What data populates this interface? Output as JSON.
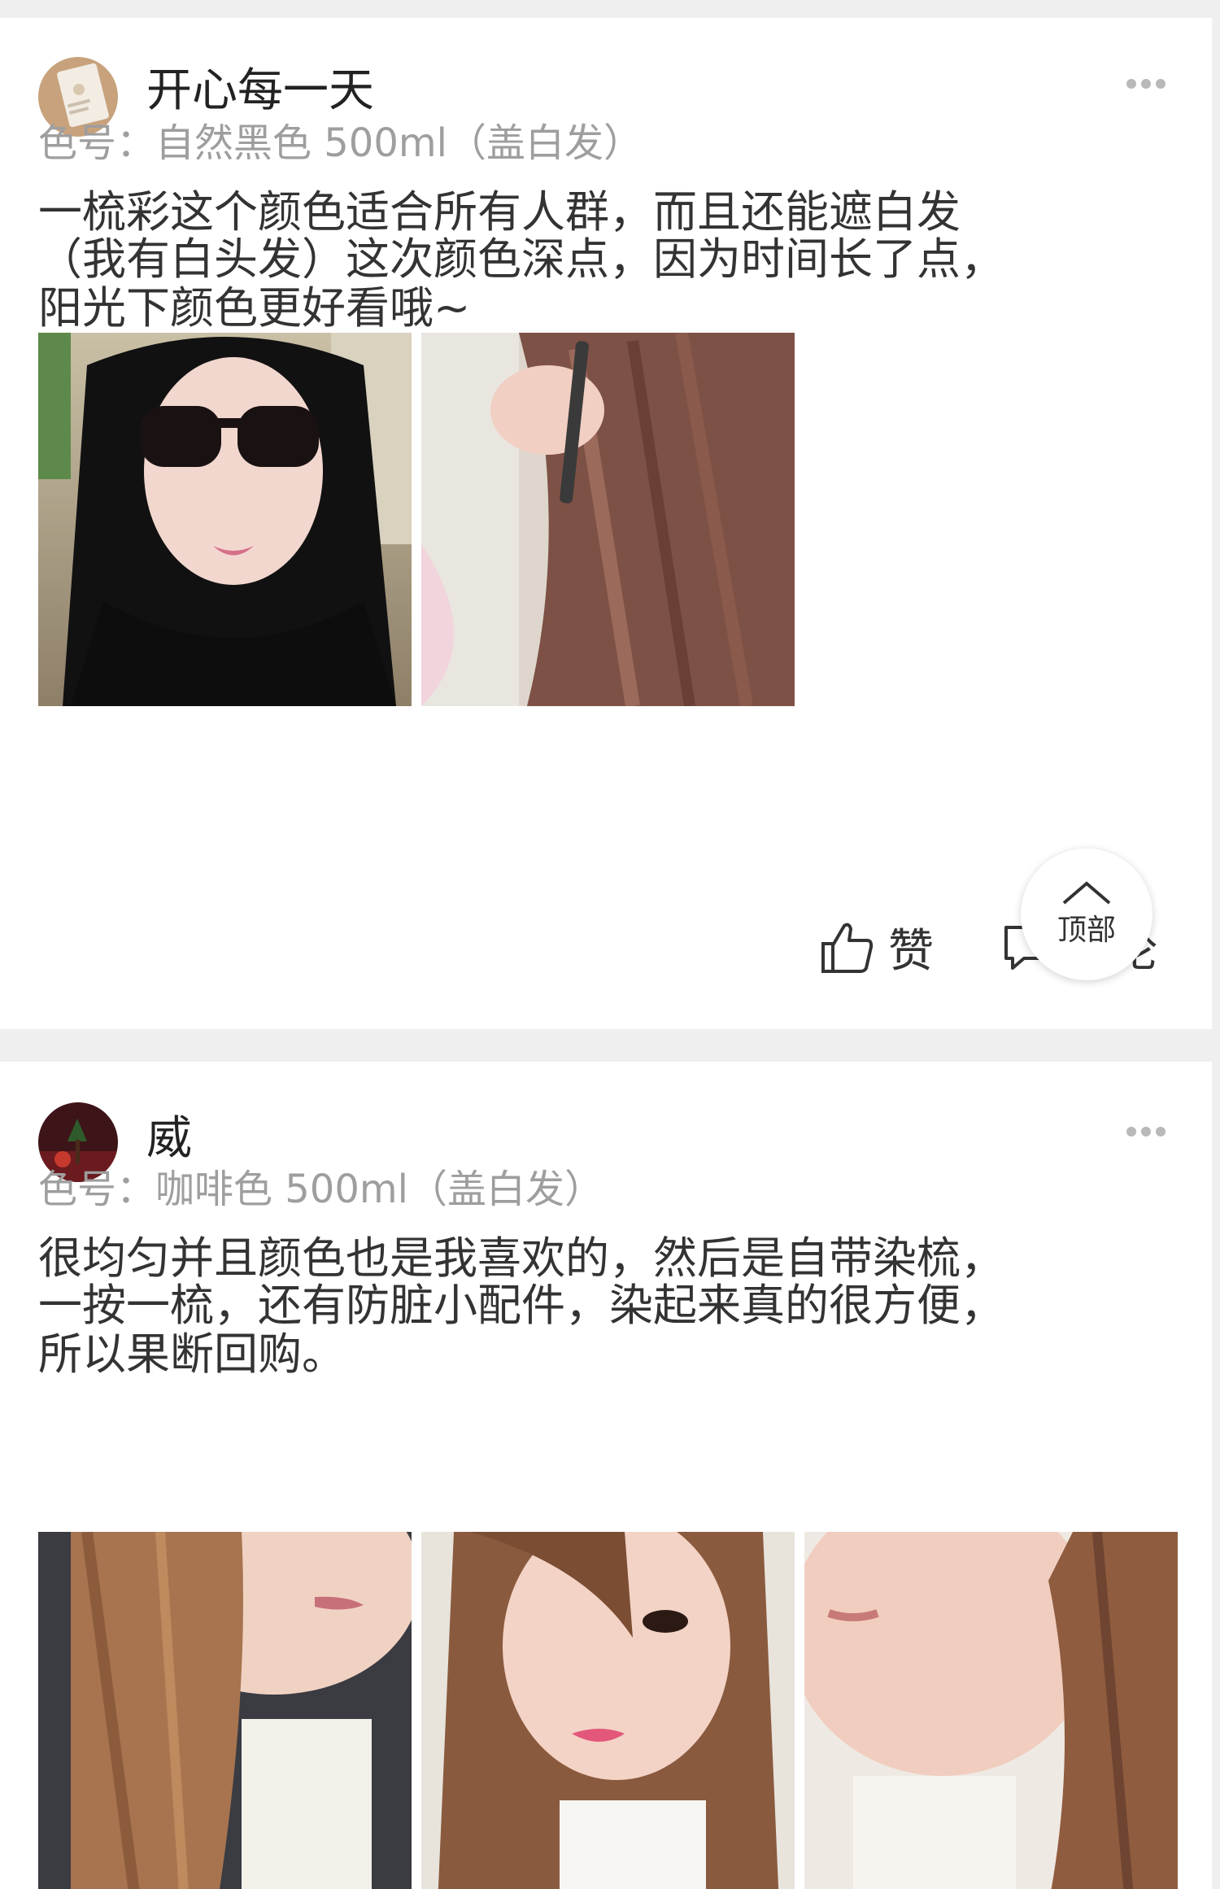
{
  "reviews": [
    {
      "username": "开心每一天",
      "spec": "色号：自然黑色 500ml（盖白发）",
      "text_lines": [
        "一梳彩这个颜色适合所有人群，而且还能遮白发",
        "（我有白头发）这次颜色深点，因为时间长了点，",
        "阳光下颜色更好看哦~"
      ],
      "photos": [
        "woman-sunglasses-black-hair-photo",
        "brown-hair-comb-photo"
      ],
      "like_label": "赞",
      "comment_label": "评论"
    },
    {
      "username": "威",
      "spec": "色号：咖啡色 500ml（盖白发）",
      "text_lines": [
        "很均匀并且颜色也是我喜欢的，然后是自带染梳，",
        "一按一梳，还有防脏小配件，染起来真的很方便，",
        "所以果断回购。"
      ],
      "photos": [
        "brown-hair-selfie-1",
        "brown-hair-selfie-2",
        "brown-hair-selfie-3"
      ]
    }
  ],
  "back_to_top": {
    "label": "顶部"
  },
  "colors": {
    "background": "#efefef",
    "card": "#ffffff",
    "text": "#333333",
    "muted": "#9e9e9e"
  }
}
